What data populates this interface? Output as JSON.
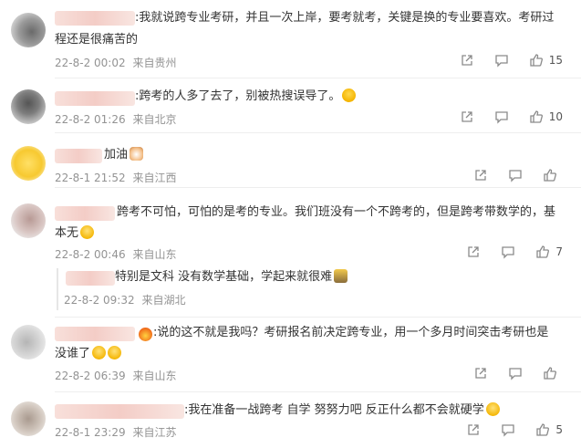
{
  "comments": [
    {
      "line1": ":我就说跨专业考研，并且一次上岸，要考就考，关键是换的专业要喜欢。考研过",
      "line2": "程还是很痛苦的",
      "date": "22-8-2 00:02",
      "location": "来自贵州",
      "likes": "15"
    },
    {
      "line1": ":跨考的人多了去了，别被热搜误导了。",
      "line2": "",
      "date": "22-8-2 01:26",
      "location": "来自北京",
      "likes": "10"
    },
    {
      "line1": "加油",
      "line2": "",
      "date": "22-8-1 21:52",
      "location": "来自江西",
      "likes": ""
    },
    {
      "line1": "跨考不可怕，可怕的是考的专业。我们班没有一个不跨考的，但是跨考带数学的，基",
      "line2": "本无",
      "date": "22-8-2 00:46",
      "location": "来自山东",
      "likes": "7",
      "reply": {
        "text": "特别是文科 没有数学基础，学起来就很难",
        "date": "22-8-2 09:32",
        "location": "来自湖北"
      }
    },
    {
      "line1": ":说的这不就是我吗？考研报名前决定跨专业，用一个多月时间突击考研也是",
      "line2": "没谁了",
      "date": "22-8-2 06:39",
      "location": "来自山东",
      "likes": ""
    },
    {
      "line1": ":我在准备一战跨考 自学 努努力吧 反正什么都不会就硬学",
      "line2": "",
      "date": "22-8-1 23:29",
      "location": "来自江苏",
      "likes": "5"
    }
  ],
  "icons": {
    "share": "share-icon",
    "comment": "comment-icon",
    "like": "thumbs-up-icon"
  }
}
